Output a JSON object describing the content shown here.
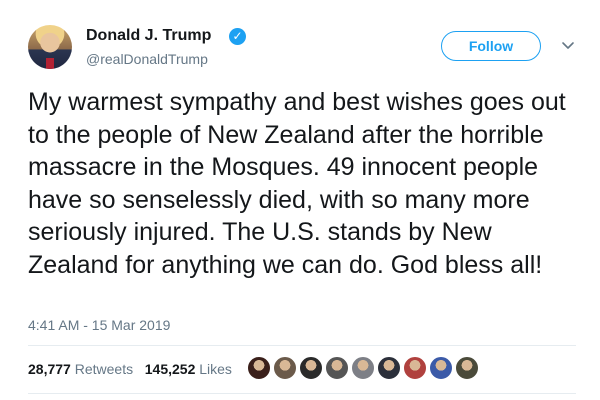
{
  "author": {
    "display_name": "Donald J. Trump",
    "handle": "@realDonaldTrump",
    "verified_icon": "verified-badge-icon"
  },
  "actions": {
    "follow_label": "Follow",
    "more_icon": "chevron-down-icon"
  },
  "tweet": {
    "text": "My warmest sympathy and best wishes goes out to the people of New Zealand after the horrible massacre in the Mosques. 49 innocent people have so senselessly died, with so many more seriously injured. The U.S. stands by New Zealand for anything we can do. God bless all!",
    "timestamp": "4:41 AM - 15 Mar 2019"
  },
  "stats": {
    "retweets_count": "28,777",
    "retweets_label": "Retweets",
    "likes_count": "145,252",
    "likes_label": "Likes"
  },
  "likers": [
    {
      "color": "#3a1f1a"
    },
    {
      "color": "#6b5a4a"
    },
    {
      "color": "#2a2a2a"
    },
    {
      "color": "#555555"
    },
    {
      "color": "#7d7f86"
    },
    {
      "color": "#2b2f3a"
    },
    {
      "color": "#b0413e"
    },
    {
      "color": "#3b5aa8"
    },
    {
      "color": "#4a4a3a"
    }
  ],
  "colors": {
    "accent": "#1da1f2",
    "text": "#14171a",
    "muted": "#657786",
    "divider": "#e6ecf0"
  }
}
